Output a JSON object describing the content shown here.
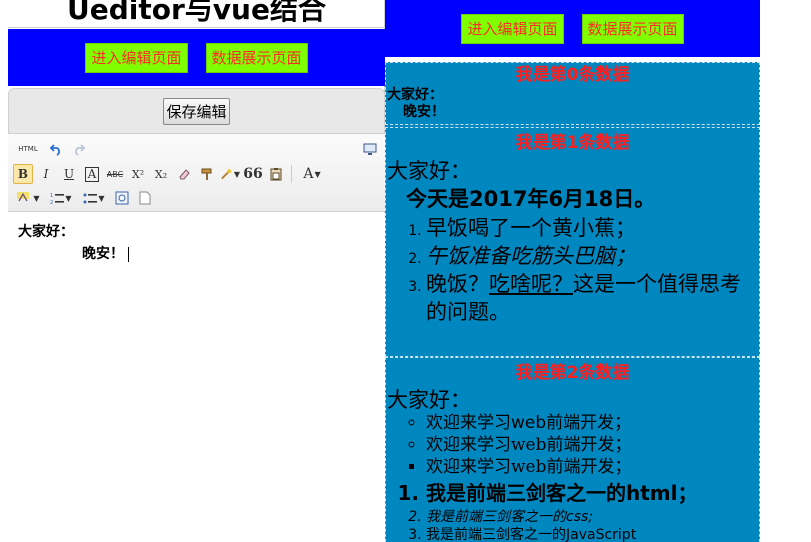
{
  "left": {
    "title": "Ueditor与vue结合",
    "nav": {
      "edit": "进入编辑页面",
      "display": "数据展示页面"
    },
    "save_label": "保存编辑",
    "toolbar": {
      "html": "HTML",
      "bold": "B",
      "italic": "I",
      "underline": "U",
      "font_border": "A",
      "strike": "ABC",
      "sup": "X²",
      "sub": "X₂",
      "quote": "66",
      "font_color": "A"
    },
    "editor": {
      "line1": "大家好：",
      "line2": "晚安！"
    }
  },
  "right": {
    "nav": {
      "edit": "进入编辑页面",
      "display": "数据展示页面"
    },
    "records": [
      {
        "title": "我是第0条数据",
        "line1": "大家好：",
        "line2": "晚安！"
      },
      {
        "title": "我是第1条数据",
        "greet": "大家好：",
        "date_line": "今天是2017年6月18日。",
        "items": [
          {
            "text": "早饭喝了一个黄小蕉；"
          },
          {
            "text": "午饭准备吃筋头巴脑；"
          },
          {
            "prefix": "晚饭？",
            "underlined": "吃啥呢？",
            "suffix": "这是一个值得思考的问题。"
          }
        ]
      },
      {
        "title": "我是第2条数据",
        "greet": "大家好：",
        "bullets": [
          "欢迎来学习web前端开发；",
          "欢迎来学习web前端开发；",
          "欢迎来学习web前端开发；"
        ],
        "numbered": [
          "我是前端三剑客之一的html；",
          "我是前端三剑客之一的css;",
          "我是前端三剑客之一的JavaScript"
        ]
      }
    ]
  }
}
